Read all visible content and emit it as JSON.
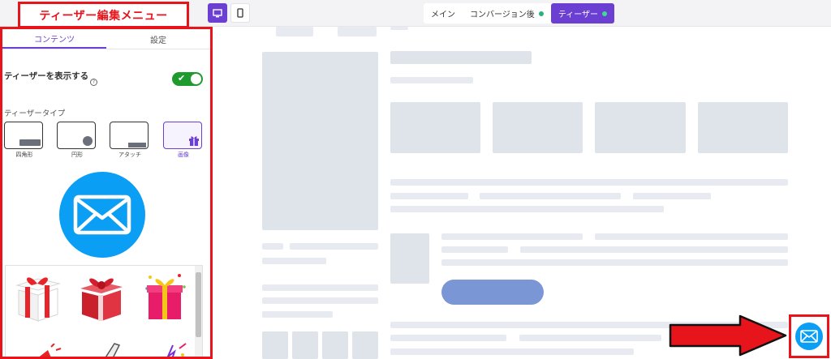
{
  "editor": {
    "title": "ティーザー編集メニュー",
    "device_toggle": {
      "desktop": "desktop-icon",
      "mobile": "mobile-icon"
    },
    "mode_tabs": [
      {
        "label": "メイン",
        "dot": false
      },
      {
        "label": "コンバージョン後",
        "dot": true
      },
      {
        "label": "ティーザー",
        "dot": true,
        "active": true
      }
    ]
  },
  "panel": {
    "tabs": [
      {
        "label": "コンテンツ",
        "active": true
      },
      {
        "label": "設定",
        "active": false
      }
    ],
    "show_teaser_label": "ティーザーを表示する",
    "help_icon": "?",
    "show_teaser_enabled": true,
    "teaser_type_label": "ティーザータイプ",
    "teaser_types": [
      {
        "label": "四角形",
        "selected": false
      },
      {
        "label": "円形",
        "selected": false
      },
      {
        "label": "アタッチ",
        "selected": false
      },
      {
        "label": "画像",
        "selected": true
      }
    ],
    "preview_icon": "envelope-icon"
  },
  "colors": {
    "accent": "#6b3fd1",
    "annotation_red": "#e8141b",
    "toggle_on": "#1e9a2e",
    "mail_blue": "#0a9ef5"
  }
}
